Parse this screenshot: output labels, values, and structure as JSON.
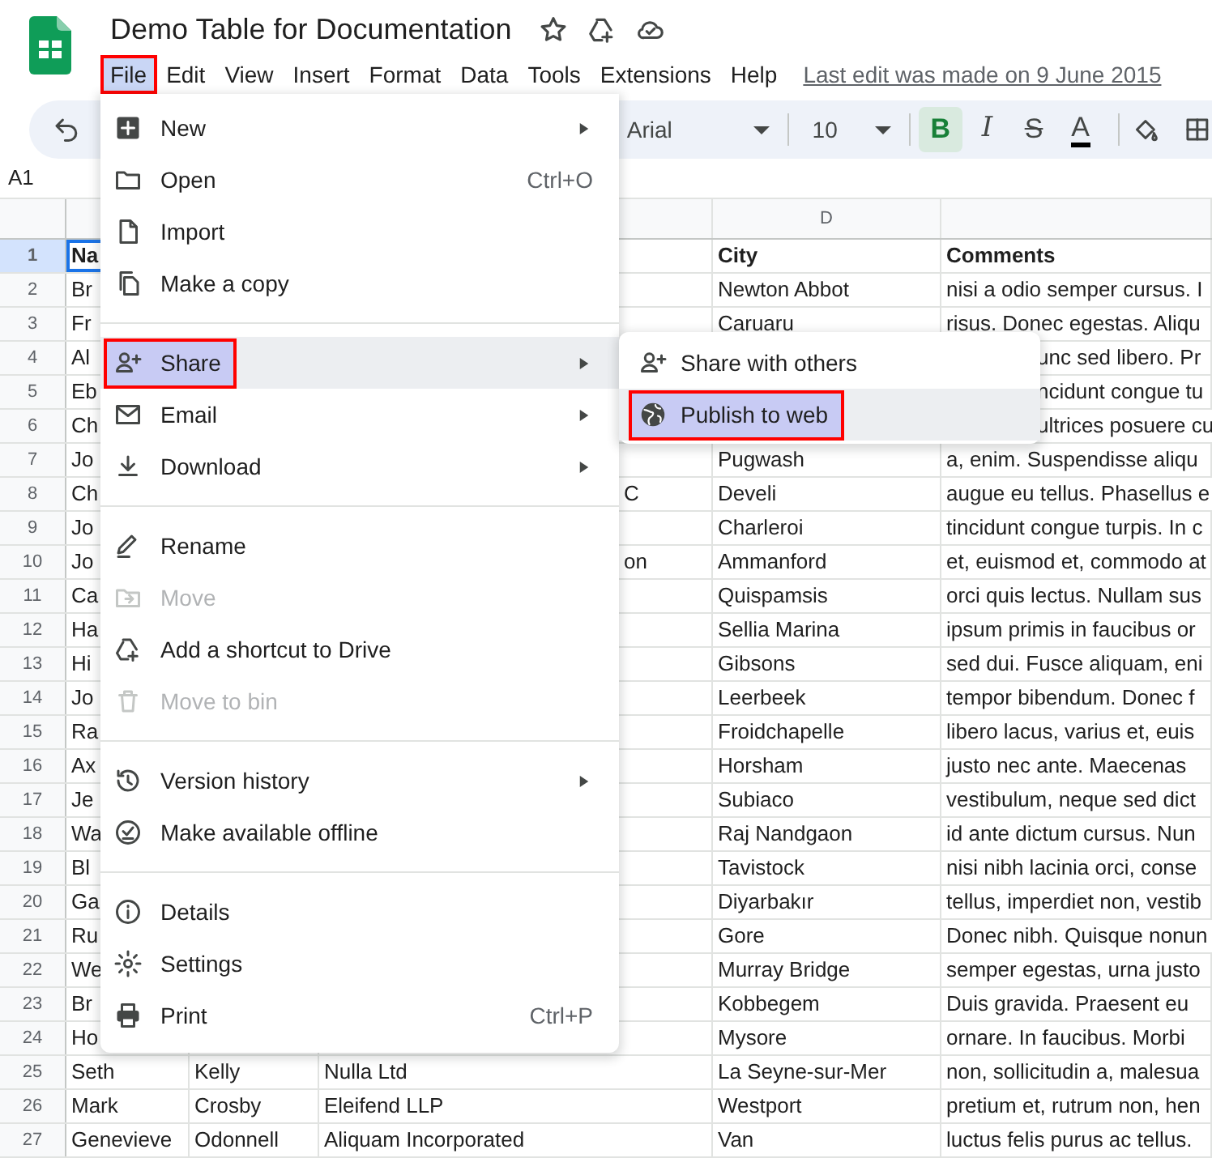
{
  "app": {
    "title": "Demo Table for Documentation",
    "last_edit": "Last edit was made on 9 June 2015"
  },
  "menubar": [
    {
      "label": "File",
      "selected": true,
      "annotated": true
    },
    {
      "label": "Edit",
      "selected": false,
      "annotated": false
    },
    {
      "label": "View",
      "selected": false,
      "annotated": false
    },
    {
      "label": "Insert",
      "selected": false,
      "annotated": false
    },
    {
      "label": "Format",
      "selected": false,
      "annotated": false
    },
    {
      "label": "Data",
      "selected": false,
      "annotated": false
    },
    {
      "label": "Tools",
      "selected": false,
      "annotated": false
    },
    {
      "label": "Extensions",
      "selected": false,
      "annotated": false
    },
    {
      "label": "Help",
      "selected": false,
      "annotated": false
    }
  ],
  "toolbar": {
    "font": "Arial",
    "size": "10",
    "format_buttons": [
      {
        "kind": "bold",
        "label": "B",
        "selected": true
      },
      {
        "kind": "italic",
        "label": "I",
        "selected": false
      },
      {
        "kind": "strike",
        "label": "S",
        "selected": false
      },
      {
        "kind": "color",
        "label": "A",
        "selected": false
      }
    ]
  },
  "name_box": "A1",
  "grid": {
    "visible_column_letter": "D",
    "rows": [
      {
        "number": "1",
        "selected": true,
        "header": true,
        "cells": {
          "a": "Na",
          "d": "City",
          "e": "Comments"
        }
      },
      {
        "number": "2",
        "selected": false,
        "header": false,
        "cells": {
          "a": "Br",
          "d": "Newton Abbot",
          "e": "nisi a odio semper cursus. I"
        }
      },
      {
        "number": "3",
        "selected": false,
        "header": false,
        "cells": {
          "a": "Fr",
          "d": "Caruaru",
          "e": "risus. Donec egestas. Aliqu"
        }
      },
      {
        "number": "4",
        "selected": false,
        "header": false,
        "cells": {
          "a": "Al",
          "e": {
            "text": "unc sed libero. Pr",
            "partly_covered": true
          }
        }
      },
      {
        "number": "5",
        "selected": false,
        "header": false,
        "cells": {
          "a": "Eb",
          "e": {
            "text": "ncidunt congue tu",
            "partly_covered": true
          }
        }
      },
      {
        "number": "6",
        "selected": false,
        "header": false,
        "cells": {
          "a": "Ch",
          "e": {
            "text": "ultrices posuere cu",
            "partly_covered": true
          }
        }
      },
      {
        "number": "7",
        "selected": false,
        "header": false,
        "cells": {
          "a": "Jo",
          "d": "Pugwash",
          "e": "a, enim. Suspendisse aliqu"
        }
      },
      {
        "number": "8",
        "selected": false,
        "header": false,
        "cells": {
          "a": "Ch",
          "c": {
            "text": "C",
            "partly_covered": true
          },
          "d": "Develi",
          "e": "augue eu tellus. Phasellus e"
        }
      },
      {
        "number": "9",
        "selected": false,
        "header": false,
        "cells": {
          "a": "Jo",
          "d": "Charleroi",
          "e": "tincidunt congue turpis. In c"
        }
      },
      {
        "number": "10",
        "selected": false,
        "header": false,
        "cells": {
          "a": "Jo",
          "c": {
            "text": "on",
            "partly_covered": true
          },
          "d": "Ammanford",
          "e": "et, euismod et, commodo at"
        }
      },
      {
        "number": "11",
        "selected": false,
        "header": false,
        "cells": {
          "a": "Ca",
          "d": "Quispamsis",
          "e": "orci quis lectus. Nullam sus"
        }
      },
      {
        "number": "12",
        "selected": false,
        "header": false,
        "cells": {
          "a": "Ha",
          "d": "Sellia Marina",
          "e": "ipsum primis in faucibus or"
        }
      },
      {
        "number": "13",
        "selected": false,
        "header": false,
        "cells": {
          "a": "Hi",
          "d": "Gibsons",
          "e": "sed dui. Fusce aliquam, eni"
        }
      },
      {
        "number": "14",
        "selected": false,
        "header": false,
        "cells": {
          "a": "Jo",
          "d": "Leerbeek",
          "e": "tempor bibendum. Donec f"
        }
      },
      {
        "number": "15",
        "selected": false,
        "header": false,
        "cells": {
          "a": "Ra",
          "d": "Froidchapelle",
          "e": "libero lacus, varius et, euis"
        }
      },
      {
        "number": "16",
        "selected": false,
        "header": false,
        "cells": {
          "a": "Ax",
          "d": "Horsham",
          "e": "justo nec ante. Maecenas"
        }
      },
      {
        "number": "17",
        "selected": false,
        "header": false,
        "cells": {
          "a": "Je",
          "d": "Subiaco",
          "e": "vestibulum, neque sed dict"
        }
      },
      {
        "number": "18",
        "selected": false,
        "header": false,
        "cells": {
          "a": "Wa",
          "d": "Raj Nandgaon",
          "e": "id ante dictum cursus. Nun"
        }
      },
      {
        "number": "19",
        "selected": false,
        "header": false,
        "cells": {
          "a": "Bl",
          "d": "Tavistock",
          "e": "nisi nibh lacinia orci, conse"
        }
      },
      {
        "number": "20",
        "selected": false,
        "header": false,
        "cells": {
          "a": "Ga",
          "d": "Diyarbakır",
          "e": "tellus, imperdiet non, vestib"
        }
      },
      {
        "number": "21",
        "selected": false,
        "header": false,
        "cells": {
          "a": "Ru",
          "d": "Gore",
          "e": "Donec nibh. Quisque nonun"
        }
      },
      {
        "number": "22",
        "selected": false,
        "header": false,
        "cells": {
          "a": "We",
          "d": "Murray Bridge",
          "e": "semper egestas, urna justo"
        }
      },
      {
        "number": "23",
        "selected": false,
        "header": false,
        "cells": {
          "a": "Br",
          "d": "Kobbegem",
          "e": "Duis gravida. Praesent eu"
        }
      },
      {
        "number": "24",
        "selected": false,
        "header": false,
        "cells": {
          "a": "Ho",
          "d": "Mysore",
          "e": "ornare. In faucibus. Morbi"
        }
      },
      {
        "number": "25",
        "selected": false,
        "header": false,
        "cells": {
          "a": "Seth",
          "b": "Kelly",
          "c": "Nulla Ltd",
          "d": "La Seyne-sur-Mer",
          "e": "non, sollicitudin a, malesua"
        }
      },
      {
        "number": "26",
        "selected": false,
        "header": false,
        "cells": {
          "a": "Mark",
          "b": "Crosby",
          "c": "Eleifend LLP",
          "d": "Westport",
          "e": "pretium et, rutrum non, hen"
        }
      },
      {
        "number": "27",
        "selected": false,
        "header": false,
        "cells": {
          "a": "Genevieve",
          "b": "Odonnell",
          "c": "Aliquam Incorporated",
          "d": "Van",
          "e": "luctus felis purus ac tellus."
        }
      }
    ]
  },
  "file_menu": {
    "groups": [
      [
        {
          "label": "New",
          "submenu": true,
          "disabled": false,
          "selected": false,
          "annotated": false
        },
        {
          "label": "Open",
          "shortcut": "Ctrl+O",
          "submenu": false,
          "disabled": false,
          "selected": false,
          "annotated": false
        },
        {
          "label": "Import",
          "submenu": false,
          "disabled": false,
          "selected": false,
          "annotated": false
        },
        {
          "label": "Make a copy",
          "submenu": false,
          "disabled": false,
          "selected": false,
          "annotated": false
        }
      ],
      [
        {
          "label": "Share",
          "submenu": true,
          "disabled": false,
          "selected": true,
          "annotated": true
        },
        {
          "label": "Email",
          "submenu": true,
          "disabled": false,
          "selected": false,
          "annotated": false
        },
        {
          "label": "Download",
          "submenu": true,
          "disabled": false,
          "selected": false,
          "annotated": false
        }
      ],
      [
        {
          "label": "Rename",
          "submenu": false,
          "disabled": false,
          "selected": false,
          "annotated": false
        },
        {
          "label": "Move",
          "submenu": false,
          "disabled": true,
          "selected": false,
          "annotated": false
        },
        {
          "label": "Add a shortcut to Drive",
          "submenu": false,
          "disabled": false,
          "selected": false,
          "annotated": false
        },
        {
          "label": "Move to bin",
          "submenu": false,
          "disabled": true,
          "selected": false,
          "annotated": false
        }
      ],
      [
        {
          "label": "Version history",
          "submenu": true,
          "disabled": false,
          "selected": false,
          "annotated": false
        },
        {
          "label": "Make available offline",
          "submenu": false,
          "disabled": false,
          "selected": false,
          "annotated": false
        }
      ],
      [
        {
          "label": "Details",
          "submenu": false,
          "disabled": false,
          "selected": false,
          "annotated": false
        },
        {
          "label": "Settings",
          "submenu": false,
          "disabled": false,
          "selected": false,
          "annotated": false
        },
        {
          "label": "Print",
          "shortcut": "Ctrl+P",
          "submenu": false,
          "disabled": false,
          "selected": false,
          "annotated": false
        }
      ]
    ]
  },
  "share_submenu": {
    "items": [
      {
        "label": "Share with others",
        "selected": false,
        "annotated": false
      },
      {
        "label": "Publish to web",
        "selected": true,
        "annotated": true
      }
    ]
  }
}
